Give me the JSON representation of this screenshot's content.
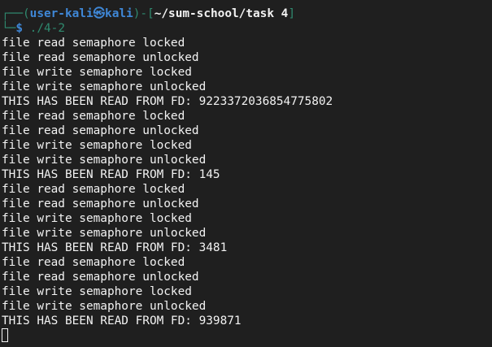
{
  "prompt": {
    "frame_top_left": "┌──(",
    "user": "user-kali",
    "at_symbol": "㉿",
    "host": "kali",
    "frame_mid": ")-[",
    "directory": "~/sum-school/task 4",
    "frame_end": "]",
    "frame_bottom": "└─",
    "dollar": "$",
    "command": "./4-2"
  },
  "output_lines": [
    "file read semaphore locked",
    "file read semaphore unlocked",
    "file write semaphore locked",
    "file write semaphore unlocked",
    "THIS HAS BEEN READ FROM FD: 9223372036854775802",
    "file read semaphore locked",
    "file read semaphore unlocked",
    "file write semaphore locked",
    "file write semaphore unlocked",
    "THIS HAS BEEN READ FROM FD: 145",
    "file read semaphore locked",
    "file read semaphore unlocked",
    "file write semaphore locked",
    "file write semaphore unlocked",
    "THIS HAS BEEN READ FROM FD: 3481",
    "file read semaphore locked",
    "file read semaphore unlocked",
    "file write semaphore locked",
    "file write semaphore unlocked",
    "THIS HAS BEEN READ FROM FD: 939871"
  ],
  "colors": {
    "background": "#1f1f1f",
    "text": "#f2f2f2",
    "prompt_frame": "#2f8a6f",
    "prompt_user": "#3f87d6"
  }
}
